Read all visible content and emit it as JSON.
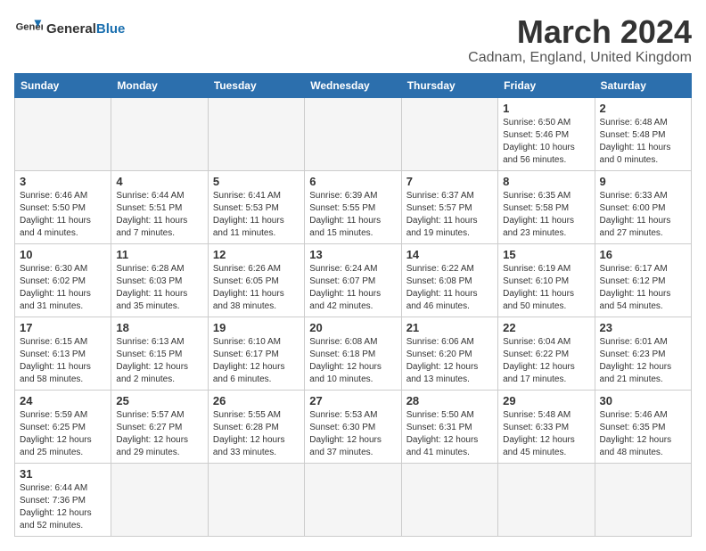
{
  "header": {
    "logo_general": "General",
    "logo_blue": "Blue",
    "title": "March 2024",
    "subtitle": "Cadnam, England, United Kingdom"
  },
  "weekdays": [
    "Sunday",
    "Monday",
    "Tuesday",
    "Wednesday",
    "Thursday",
    "Friday",
    "Saturday"
  ],
  "weeks": [
    [
      {
        "day": "",
        "info": "",
        "empty": true
      },
      {
        "day": "",
        "info": "",
        "empty": true
      },
      {
        "day": "",
        "info": "",
        "empty": true
      },
      {
        "day": "",
        "info": "",
        "empty": true
      },
      {
        "day": "",
        "info": "",
        "empty": true
      },
      {
        "day": "1",
        "info": "Sunrise: 6:50 AM\nSunset: 5:46 PM\nDaylight: 10 hours and 56 minutes."
      },
      {
        "day": "2",
        "info": "Sunrise: 6:48 AM\nSunset: 5:48 PM\nDaylight: 11 hours and 0 minutes."
      }
    ],
    [
      {
        "day": "3",
        "info": "Sunrise: 6:46 AM\nSunset: 5:50 PM\nDaylight: 11 hours and 4 minutes."
      },
      {
        "day": "4",
        "info": "Sunrise: 6:44 AM\nSunset: 5:51 PM\nDaylight: 11 hours and 7 minutes."
      },
      {
        "day": "5",
        "info": "Sunrise: 6:41 AM\nSunset: 5:53 PM\nDaylight: 11 hours and 11 minutes."
      },
      {
        "day": "6",
        "info": "Sunrise: 6:39 AM\nSunset: 5:55 PM\nDaylight: 11 hours and 15 minutes."
      },
      {
        "day": "7",
        "info": "Sunrise: 6:37 AM\nSunset: 5:57 PM\nDaylight: 11 hours and 19 minutes."
      },
      {
        "day": "8",
        "info": "Sunrise: 6:35 AM\nSunset: 5:58 PM\nDaylight: 11 hours and 23 minutes."
      },
      {
        "day": "9",
        "info": "Sunrise: 6:33 AM\nSunset: 6:00 PM\nDaylight: 11 hours and 27 minutes."
      }
    ],
    [
      {
        "day": "10",
        "info": "Sunrise: 6:30 AM\nSunset: 6:02 PM\nDaylight: 11 hours and 31 minutes."
      },
      {
        "day": "11",
        "info": "Sunrise: 6:28 AM\nSunset: 6:03 PM\nDaylight: 11 hours and 35 minutes."
      },
      {
        "day": "12",
        "info": "Sunrise: 6:26 AM\nSunset: 6:05 PM\nDaylight: 11 hours and 38 minutes."
      },
      {
        "day": "13",
        "info": "Sunrise: 6:24 AM\nSunset: 6:07 PM\nDaylight: 11 hours and 42 minutes."
      },
      {
        "day": "14",
        "info": "Sunrise: 6:22 AM\nSunset: 6:08 PM\nDaylight: 11 hours and 46 minutes."
      },
      {
        "day": "15",
        "info": "Sunrise: 6:19 AM\nSunset: 6:10 PM\nDaylight: 11 hours and 50 minutes."
      },
      {
        "day": "16",
        "info": "Sunrise: 6:17 AM\nSunset: 6:12 PM\nDaylight: 11 hours and 54 minutes."
      }
    ],
    [
      {
        "day": "17",
        "info": "Sunrise: 6:15 AM\nSunset: 6:13 PM\nDaylight: 11 hours and 58 minutes."
      },
      {
        "day": "18",
        "info": "Sunrise: 6:13 AM\nSunset: 6:15 PM\nDaylight: 12 hours and 2 minutes."
      },
      {
        "day": "19",
        "info": "Sunrise: 6:10 AM\nSunset: 6:17 PM\nDaylight: 12 hours and 6 minutes."
      },
      {
        "day": "20",
        "info": "Sunrise: 6:08 AM\nSunset: 6:18 PM\nDaylight: 12 hours and 10 minutes."
      },
      {
        "day": "21",
        "info": "Sunrise: 6:06 AM\nSunset: 6:20 PM\nDaylight: 12 hours and 13 minutes."
      },
      {
        "day": "22",
        "info": "Sunrise: 6:04 AM\nSunset: 6:22 PM\nDaylight: 12 hours and 17 minutes."
      },
      {
        "day": "23",
        "info": "Sunrise: 6:01 AM\nSunset: 6:23 PM\nDaylight: 12 hours and 21 minutes."
      }
    ],
    [
      {
        "day": "24",
        "info": "Sunrise: 5:59 AM\nSunset: 6:25 PM\nDaylight: 12 hours and 25 minutes."
      },
      {
        "day": "25",
        "info": "Sunrise: 5:57 AM\nSunset: 6:27 PM\nDaylight: 12 hours and 29 minutes."
      },
      {
        "day": "26",
        "info": "Sunrise: 5:55 AM\nSunset: 6:28 PM\nDaylight: 12 hours and 33 minutes."
      },
      {
        "day": "27",
        "info": "Sunrise: 5:53 AM\nSunset: 6:30 PM\nDaylight: 12 hours and 37 minutes."
      },
      {
        "day": "28",
        "info": "Sunrise: 5:50 AM\nSunset: 6:31 PM\nDaylight: 12 hours and 41 minutes."
      },
      {
        "day": "29",
        "info": "Sunrise: 5:48 AM\nSunset: 6:33 PM\nDaylight: 12 hours and 45 minutes."
      },
      {
        "day": "30",
        "info": "Sunrise: 5:46 AM\nSunset: 6:35 PM\nDaylight: 12 hours and 48 minutes."
      }
    ],
    [
      {
        "day": "31",
        "info": "Sunrise: 6:44 AM\nSunset: 7:36 PM\nDaylight: 12 hours and 52 minutes."
      },
      {
        "day": "",
        "info": "",
        "empty": true
      },
      {
        "day": "",
        "info": "",
        "empty": true
      },
      {
        "day": "",
        "info": "",
        "empty": true
      },
      {
        "day": "",
        "info": "",
        "empty": true
      },
      {
        "day": "",
        "info": "",
        "empty": true
      },
      {
        "day": "",
        "info": "",
        "empty": true
      }
    ]
  ]
}
